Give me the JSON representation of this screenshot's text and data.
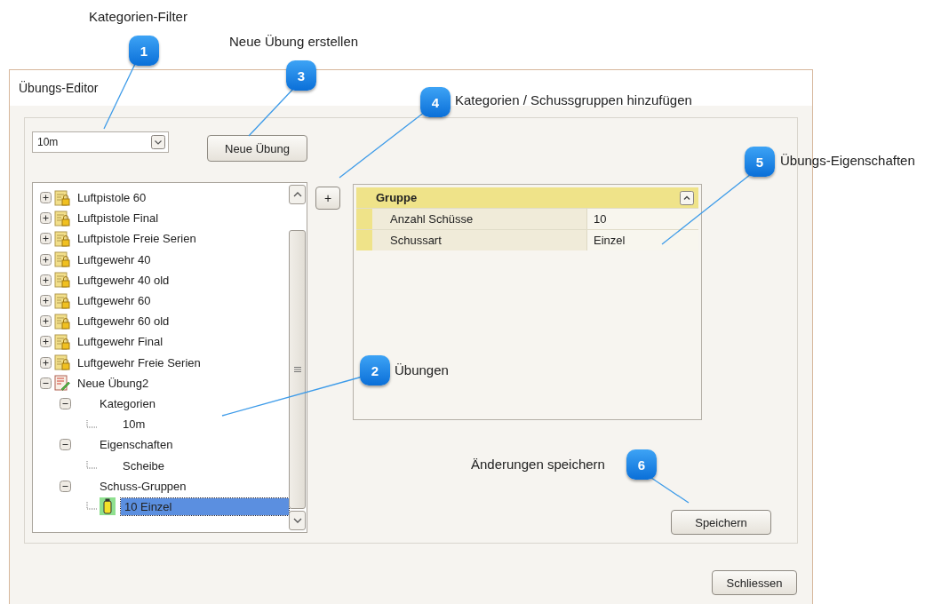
{
  "annotations": [
    {
      "number": "1",
      "label": "Kategorien-Filter"
    },
    {
      "number": "3",
      "label": "Neue Übung erstellen"
    },
    {
      "number": "4",
      "label": "Kategorien / Schussgruppen hinzufügen"
    },
    {
      "number": "5",
      "label": "Übungs-Eigenschaften"
    },
    {
      "number": "2",
      "label": "Übungen"
    },
    {
      "number": "6",
      "label": "Änderungen speichern"
    }
  ],
  "dialog": {
    "title": "Übungs-Editor",
    "category_filter": {
      "value": "10m"
    },
    "new_button": "Neue Übung",
    "add_button": "+",
    "tree": [
      {
        "label": "Luftpistole 60",
        "kind": "locked",
        "expanded": false,
        "selected": false
      },
      {
        "label": "Luftpistole Final",
        "kind": "locked",
        "expanded": false,
        "selected": false
      },
      {
        "label": "Luftpistole Freie Serien",
        "kind": "locked",
        "expanded": false,
        "selected": false
      },
      {
        "label": "Luftgewehr 40",
        "kind": "locked",
        "expanded": false,
        "selected": false
      },
      {
        "label": "Luftgewehr 40 old",
        "kind": "locked",
        "expanded": false,
        "selected": false
      },
      {
        "label": "Luftgewehr 60",
        "kind": "locked",
        "expanded": false,
        "selected": false
      },
      {
        "label": "Luftgewehr 60 old",
        "kind": "locked",
        "expanded": false,
        "selected": false
      },
      {
        "label": "Luftgewehr Final",
        "kind": "locked",
        "expanded": false,
        "selected": false
      },
      {
        "label": "Luftgewehr Freie Serien",
        "kind": "locked",
        "expanded": false,
        "selected": false
      },
      {
        "label": "Neue Übung2",
        "kind": "edited",
        "expanded": true,
        "selected": false,
        "children": [
          {
            "label": "Kategorien",
            "expanded": true,
            "selected": false,
            "children": [
              {
                "label": "10m",
                "selected": false
              }
            ]
          },
          {
            "label": "Eigenschaften",
            "expanded": true,
            "selected": false,
            "children": [
              {
                "label": "Scheibe",
                "selected": false
              }
            ]
          },
          {
            "label": "Schuss-Gruppen",
            "expanded": true,
            "selected": false,
            "children": [
              {
                "label": "10 Einzel",
                "kind": "group",
                "selected": true
              }
            ]
          }
        ]
      }
    ],
    "properties": {
      "group": "Gruppe",
      "expanded": true,
      "rows": [
        {
          "name": "Anzahl Schüsse",
          "value": "10"
        },
        {
          "name": "Schussart",
          "value": "Einzel"
        }
      ]
    },
    "save_button": "Speichern",
    "close_button": "Schliessen"
  }
}
